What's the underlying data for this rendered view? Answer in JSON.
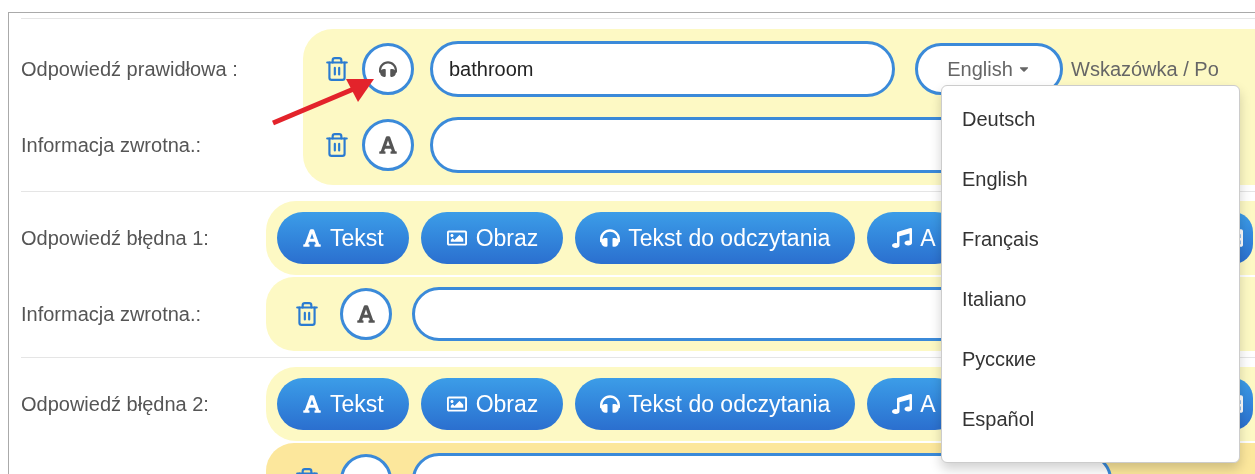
{
  "correct": {
    "label": "Odpowiedź prawidłowa :",
    "kind": "speech",
    "value": "bathroom",
    "language": "English",
    "hint": "Wskazówka / Po",
    "feedback": {
      "label": "Informacja zwrotna.:",
      "kind": "text"
    }
  },
  "wrong": [
    {
      "label": "Odpowiedź błędna 1:",
      "buttons": [
        {
          "kind": "text",
          "label": "Tekst"
        },
        {
          "kind": "image",
          "label": "Obraz"
        },
        {
          "kind": "speech",
          "label": "Tekst do odczytania"
        },
        {
          "kind": "audio",
          "label": "A"
        },
        {
          "kind": "table"
        }
      ],
      "feedback": {
        "label": "Informacja zwrotna.:",
        "kind": "text",
        "hovered": false
      }
    },
    {
      "label": "Odpowiedź błędna 2:",
      "buttons": [
        {
          "kind": "text",
          "label": "Tekst"
        },
        {
          "kind": "image",
          "label": "Obraz"
        },
        {
          "kind": "speech",
          "label": "Tekst do odczytania"
        },
        {
          "kind": "audio",
          "label": "A"
        },
        {
          "kind": "table"
        }
      ],
      "feedback": {
        "hovered": true
      }
    }
  ],
  "language_menu": {
    "open": true,
    "options": [
      {
        "label": "Deutsch"
      },
      {
        "label": "English"
      },
      {
        "label": "Français"
      },
      {
        "label": "Italiano"
      },
      {
        "label": "Русские"
      },
      {
        "label": "Español"
      }
    ]
  }
}
